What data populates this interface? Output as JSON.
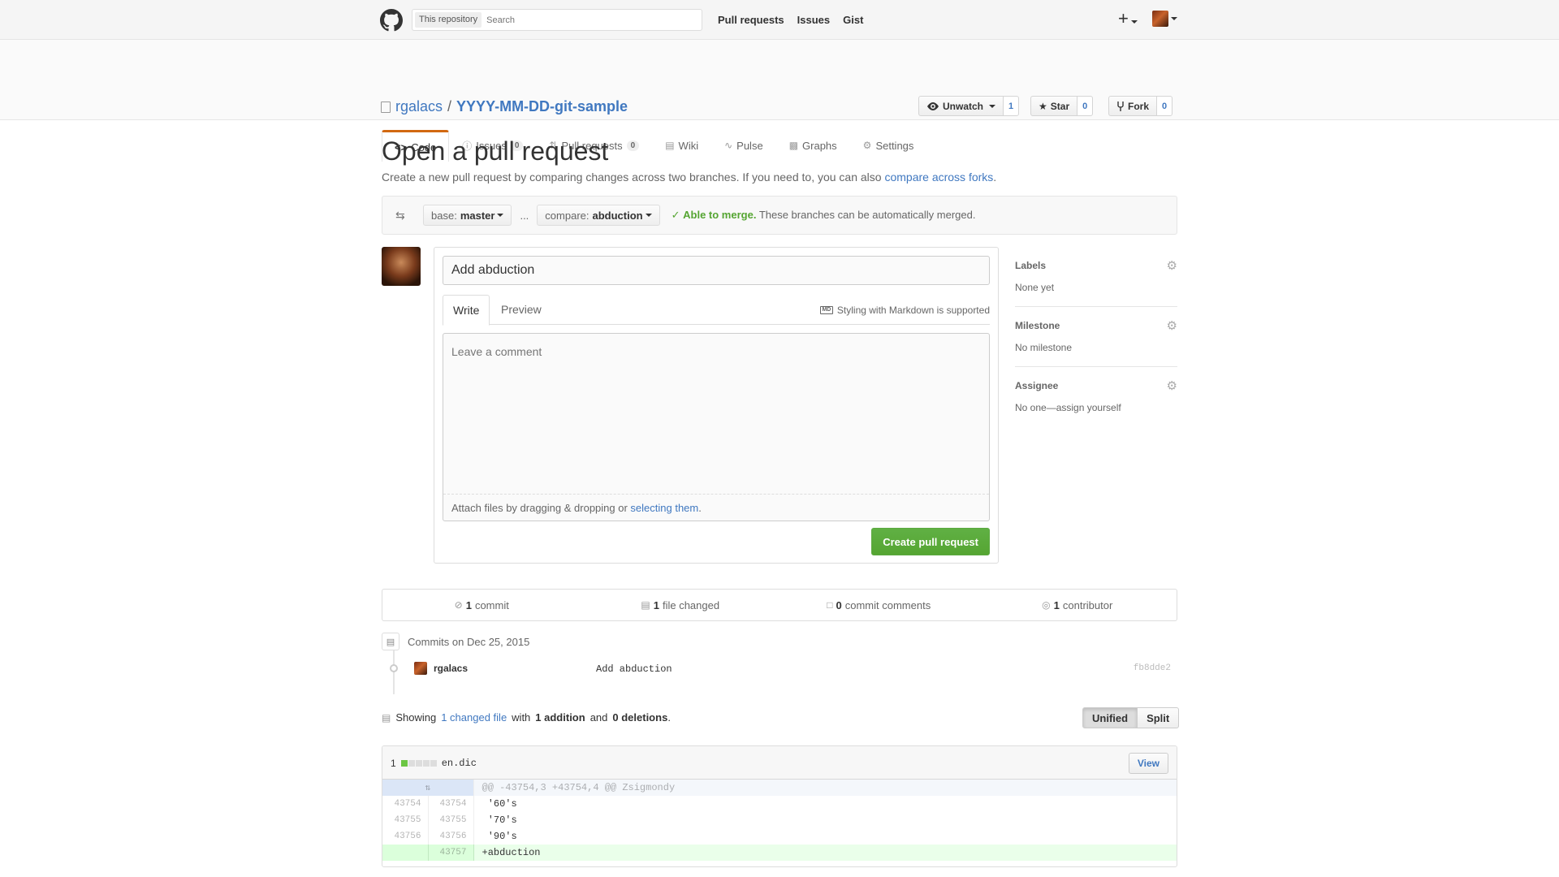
{
  "header": {
    "scope_label": "This repository",
    "search_placeholder": "Search",
    "nav": [
      "Pull requests",
      "Issues",
      "Gist"
    ],
    "plus": "+"
  },
  "repo": {
    "owner": "rgalacs",
    "separator": "/",
    "name": "YYYY-MM-DD-git-sample",
    "unwatch_label": "Unwatch",
    "watch_count": "1",
    "star_label": "Star",
    "star_count": "0",
    "fork_label": "Fork",
    "fork_count": "0"
  },
  "reponav": {
    "code": "Code",
    "issues": "Issues",
    "issues_count": "0",
    "pulls": "Pull requests",
    "pulls_count": "0",
    "wiki": "Wiki",
    "pulse": "Pulse",
    "graphs": "Graphs",
    "settings": "Settings"
  },
  "page": {
    "title": "Open a pull request",
    "subtitle_text": "Create a new pull request by comparing changes across two branches. If you need to, you can also ",
    "subtitle_link": "compare across forks",
    "subtitle_end": "."
  },
  "range": {
    "base_label": "base:",
    "base_value": "master",
    "dots": "...",
    "compare_label": "compare:",
    "compare_value": "abduction",
    "merge_ok": "Able to merge.",
    "merge_text": " These branches can be automatically merged."
  },
  "form": {
    "title_value": "Add abduction",
    "tab_write": "Write",
    "tab_preview": "Preview",
    "md_hint": "Styling with Markdown is supported",
    "md_icon": "MD",
    "comment_placeholder": "Leave a comment",
    "attach_text": "Attach files by dragging & dropping or ",
    "attach_link": "selecting them",
    "attach_end": ".",
    "submit": "Create pull request"
  },
  "sidebar": {
    "labels_head": "Labels",
    "labels_val": "None yet",
    "milestone_head": "Milestone",
    "milestone_val": "No milestone",
    "assignee_head": "Assignee",
    "assignee_val": "No one—assign yourself"
  },
  "numbers": {
    "commits_count": "1",
    "commits_label": "commit",
    "files_count": "1",
    "files_label": "file changed",
    "comments_count": "0",
    "comments_label": "commit comments",
    "contrib_count": "1",
    "contrib_label": "contributor"
  },
  "commits": {
    "group_title": "Commits on Dec 25, 2015",
    "author": "rgalacs",
    "message": "Add abduction",
    "sha": "fb8dde2"
  },
  "toc": {
    "showing": "Showing",
    "changed_link": "1 changed file",
    "with": "with",
    "additions": "1 addition",
    "and": "and",
    "deletions": "0 deletions",
    "period": ".",
    "unified": "Unified",
    "split": "Split"
  },
  "file": {
    "stat_number": "1",
    "name": "en.dic",
    "view": "View",
    "hunk": "@@ -43754,3 +43754,4 @@ Zsigmondy",
    "lines": [
      {
        "old": "43754",
        "new": "43754",
        "code": " '60's"
      },
      {
        "old": "43755",
        "new": "43755",
        "code": " '70's"
      },
      {
        "old": "43756",
        "new": "43756",
        "code": " '90's"
      },
      {
        "old": "",
        "new": "43757",
        "code": "+abduction"
      }
    ]
  },
  "colors": {
    "accent": "#4078c0",
    "success": "#55a532",
    "nav_selected": "#d26911"
  }
}
